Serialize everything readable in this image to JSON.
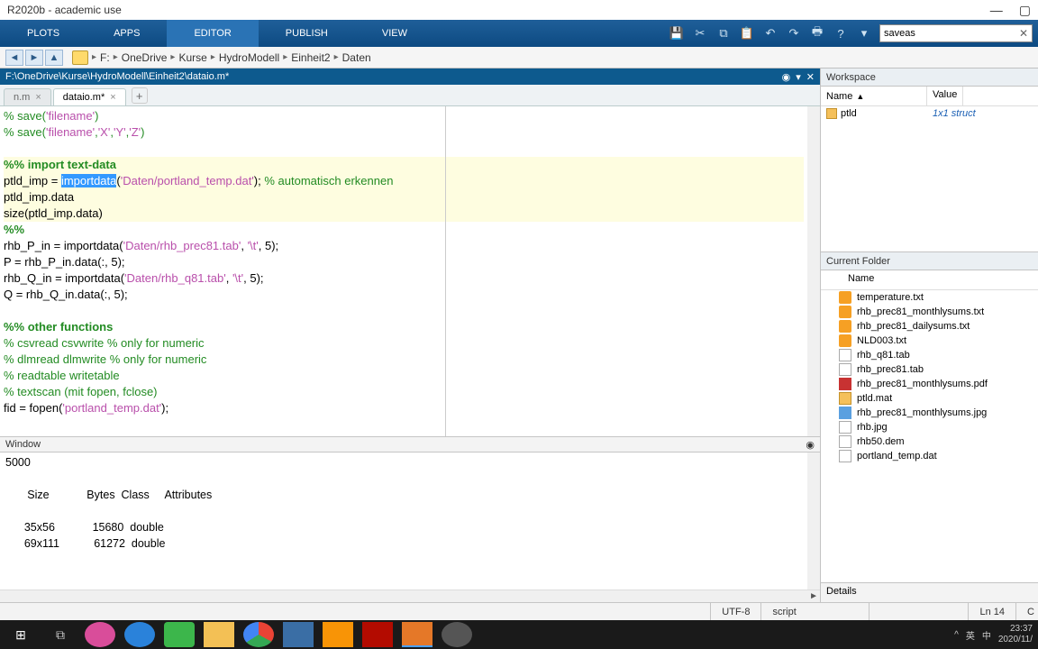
{
  "titlebar": {
    "text": "R2020b - academic use"
  },
  "tabs": {
    "plots": "PLOTS",
    "apps": "APPS",
    "editor": "EDITOR",
    "publish": "PUBLISH",
    "view": "VIEW"
  },
  "search": {
    "value": "saveas"
  },
  "breadcrumb": {
    "drive": "F:",
    "p1": "OneDrive",
    "p2": "Kurse",
    "p3": "HydroModell",
    "p4": "Einheit2",
    "p5": "Daten"
  },
  "editor_path": "F:\\OneDrive\\Kurse\\HydroModell\\Einheit2\\dataio.m*",
  "filetabs": {
    "t1": "n.m",
    "t2": "dataio.m*"
  },
  "code": {
    "l1a": "% save(",
    "l1b": "'filename'",
    "l1c": ")",
    "l2a": "% save(",
    "l2b": "'filename'",
    "l2c": ",",
    "l2d": "'X'",
    "l2e": ",",
    "l2f": "'Y'",
    "l2g": ",",
    "l2h": "'Z'",
    "l2i": ")",
    "l3": "%% import text-data",
    "l4a": "ptld_imp = ",
    "l4b": "import",
    "l4c": "data",
    "l4d": "(",
    "l4e": "'Daten/portland_temp.dat'",
    "l4f": "); ",
    "l4g": "% automatisch erkennen",
    "l5": "ptld_imp.data",
    "l6": "size(ptld_imp.data)",
    "l7": "%%",
    "l8a": "rhb_P_in = importdata(",
    "l8b": "'Daten/rhb_prec81.tab'",
    "l8c": ", ",
    "l8d": "'\\t'",
    "l8e": ", 5);",
    "l9": "P = rhb_P_in.data(:, 5);",
    "l10a": "rhb_Q_in = importdata(",
    "l10b": "'Daten/rhb_q81.tab'",
    "l10c": ", ",
    "l10d": "'\\t'",
    "l10e": ", 5);",
    "l11": "Q = rhb_Q_in.data(:, 5);",
    "l12": "%% other functions",
    "l13": "% csvread csvwrite % only for numeric",
    "l14": "% dlmread dlmwrite % only for numeric",
    "l15": "% readtable writetable",
    "l16": "% textscan (mit fopen, fclose)",
    "l17a": "fid = fopen(",
    "l17b": "'portland_temp.dat'",
    "l17c": ");"
  },
  "cmdwin": {
    "title": "Window",
    "l1": "5000",
    "hdr": "       Size            Bytes  Class     Attributes",
    "r1": "      35x56            15680  double",
    "r2": "      69x111           61272  double"
  },
  "workspace": {
    "title": "Workspace",
    "col_name": "Name",
    "col_value": "Value",
    "row1_name": "ptld",
    "row1_val": "1x1 struct"
  },
  "current_folder": {
    "title": "Current Folder",
    "col": "Name",
    "files": [
      {
        "n": "temperature.txt",
        "t": "code"
      },
      {
        "n": "rhb_prec81_monthlysums.txt",
        "t": "code"
      },
      {
        "n": "rhb_prec81_dailysums.txt",
        "t": "code"
      },
      {
        "n": "NLD003.txt",
        "t": "code"
      },
      {
        "n": "rhb_q81.tab",
        "t": "txt"
      },
      {
        "n": "rhb_prec81.tab",
        "t": "txt"
      },
      {
        "n": "rhb_prec81_monthlysums.pdf",
        "t": "pdf"
      },
      {
        "n": "ptld.mat",
        "t": "mat"
      },
      {
        "n": "rhb_prec81_monthlysums.jpg",
        "t": "jpg"
      },
      {
        "n": "rhb.jpg",
        "t": "txt"
      },
      {
        "n": "rhb50.dem",
        "t": "txt"
      },
      {
        "n": "portland_temp.dat",
        "t": "txt"
      }
    ]
  },
  "details": "Details",
  "status": {
    "enc": "UTF-8",
    "type": "script",
    "ln": "Ln  14"
  },
  "clock": {
    "time": "23:37",
    "date": "2020/11/"
  },
  "ime": {
    "a": "英",
    "b": "中"
  }
}
